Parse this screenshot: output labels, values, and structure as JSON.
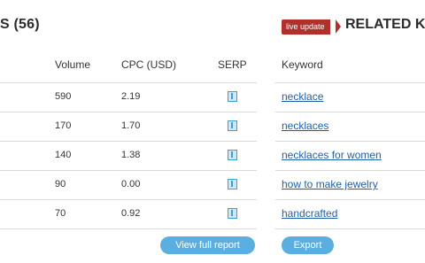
{
  "left_panel": {
    "title": "S (56)",
    "columns": {
      "volume": "Volume",
      "cpc": "CPC (USD)",
      "serp": "SERP"
    },
    "rows": [
      {
        "volume": "590",
        "cpc": "2.19"
      },
      {
        "volume": "170",
        "cpc": "1.70"
      },
      {
        "volume": "140",
        "cpc": "1.38"
      },
      {
        "volume": "90",
        "cpc": "0.00"
      },
      {
        "volume": "70",
        "cpc": "0.92"
      }
    ],
    "button": "View full report"
  },
  "right_panel": {
    "badge": "live update",
    "title": "RELATED K",
    "column": "Keyword",
    "keywords": [
      "necklace",
      "necklaces",
      "necklaces for women",
      "how to make jewelry",
      "handcrafted"
    ],
    "button": "Export"
  },
  "colors": {
    "badge": "#b0302c",
    "link": "#1f5fa8",
    "button": "#5aaee0",
    "icon": "#3aa0d8"
  }
}
